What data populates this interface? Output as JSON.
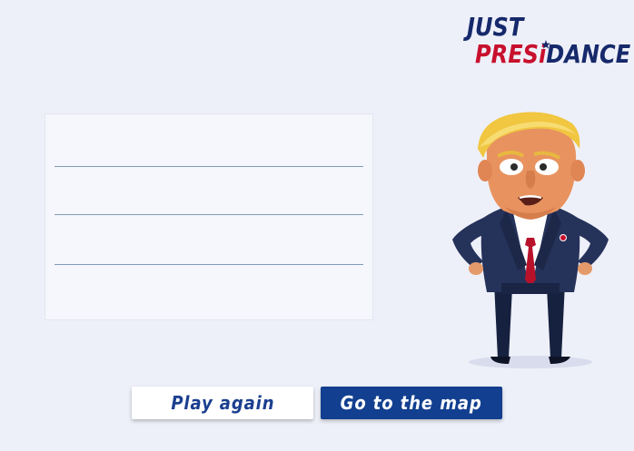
{
  "logo": {
    "line1": "JUST",
    "line2_red": "PRES",
    "line2_i": "i",
    "line2_blue": "DANCE"
  },
  "results_panel": {
    "rows": [
      "",
      "",
      "",
      ""
    ]
  },
  "buttons": {
    "play_again": "Play again",
    "go_to_map": "Go to the map"
  },
  "colors": {
    "background": "#eef0f9",
    "logo_blue": "#16296b",
    "logo_red": "#c8102e",
    "map_button": "#123f8f",
    "play_button_text": "#1b3f8f"
  },
  "character": {
    "icon": "cartoon-president-character"
  }
}
